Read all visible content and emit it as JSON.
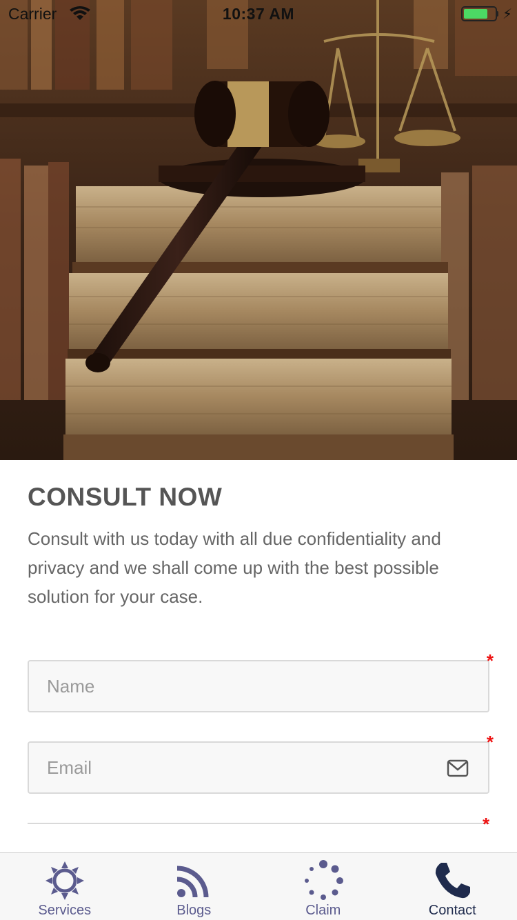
{
  "status_bar": {
    "carrier": "Carrier",
    "time": "10:37 AM",
    "battery_color": "#4cd964"
  },
  "hero": {
    "image_description_icon": "gavel-on-books-image"
  },
  "consult": {
    "title": "CONSULT NOW",
    "description": "Consult with us today with all due confidentiality and privacy and we shall come up with the best possible solution for your case."
  },
  "form": {
    "name_placeholder": "Name",
    "email_placeholder": "Email",
    "required_marker": "*"
  },
  "tabs": [
    {
      "label": "Services",
      "icon": "sun-icon",
      "active": false
    },
    {
      "label": "Blogs",
      "icon": "rss-icon",
      "active": false
    },
    {
      "label": "Claim",
      "icon": "spinner-icon",
      "active": false
    },
    {
      "label": "Contact",
      "icon": "phone-icon",
      "active": true
    }
  ],
  "colors": {
    "tab_inactive": "#5b5b8e",
    "tab_active": "#1f2b4d",
    "required": "#ee1111"
  }
}
